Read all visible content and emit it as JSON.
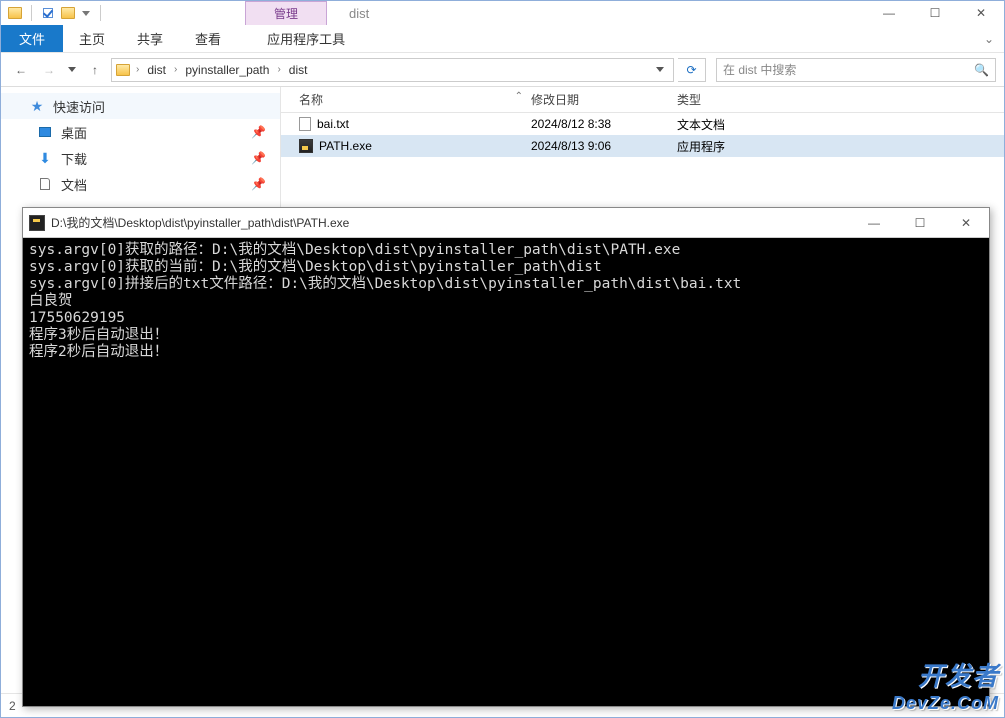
{
  "titlebar": {
    "manage": "管理",
    "title": "dist"
  },
  "ribbon": {
    "file": "文件",
    "home": "主页",
    "share": "共享",
    "view": "查看",
    "apptool": "应用程序工具"
  },
  "breadcrumbs": [
    "dist",
    "pyinstaller_path",
    "dist"
  ],
  "search": {
    "placeholder": "在 dist 中搜索"
  },
  "sidebar": {
    "quick": "快速访问",
    "items": [
      "桌面",
      "下载",
      "文档"
    ]
  },
  "columns": {
    "name": "名称",
    "date": "修改日期",
    "type": "类型"
  },
  "files": [
    {
      "name": "bai.txt",
      "date": "2024/8/12 8:38",
      "type": "文本文档",
      "selected": false,
      "icon": "txt"
    },
    {
      "name": "PATH.exe",
      "date": "2024/8/13 9:06",
      "type": "应用程序",
      "selected": true,
      "icon": "exe"
    }
  ],
  "statusbar": {
    "count": "2"
  },
  "console": {
    "title": "D:\\我的文档\\Desktop\\dist\\pyinstaller_path\\dist\\PATH.exe",
    "lines": [
      "sys.argv[0]获取的路径：D:\\我的文档\\Desktop\\dist\\pyinstaller_path\\dist\\PATH.exe",
      "sys.argv[0]获取的当前：D:\\我的文档\\Desktop\\dist\\pyinstaller_path\\dist",
      "sys.argv[0]拼接后的txt文件路径：D:\\我的文档\\Desktop\\dist\\pyinstaller_path\\dist\\bai.txt",
      "白良贺",
      "17550629195",
      "程序3秒后自动退出！",
      "程序2秒后自动退出！"
    ]
  },
  "watermark": {
    "l1": "开发者",
    "l2": "DevZe.CoM"
  }
}
